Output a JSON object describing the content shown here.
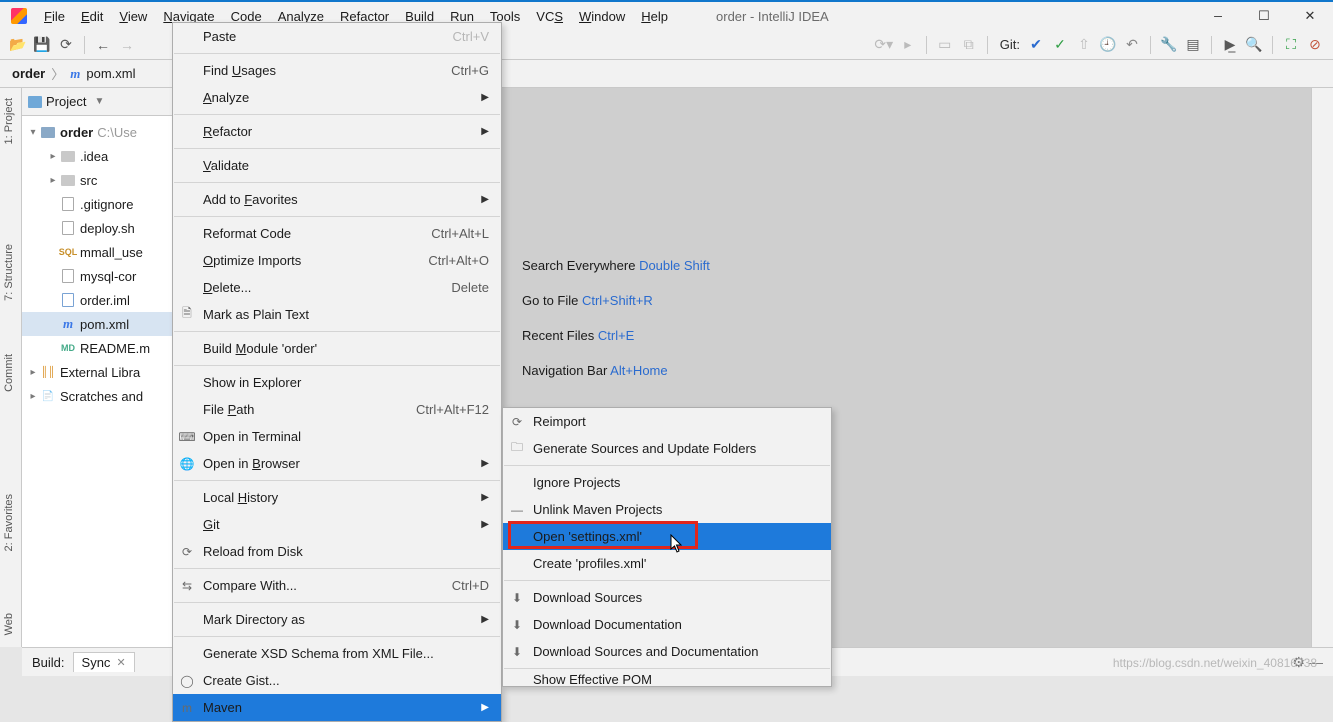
{
  "title": "order - IntelliJ IDEA",
  "menu": [
    "File",
    "Edit",
    "View",
    "Navigate",
    "Code",
    "Analyze",
    "Refactor",
    "Build",
    "Run",
    "Tools",
    "VCS",
    "Window",
    "Help"
  ],
  "toolbar_git_label": "Git:",
  "breadcrumb": {
    "root": "order",
    "file": "pom.xml"
  },
  "sidebar_tabs": {
    "project": "1: Project",
    "structure": "7: Structure",
    "commit": "Commit",
    "favorites": "2: Favorites",
    "web": "Web"
  },
  "project_header": "Project",
  "tree": {
    "root": "order",
    "root_path": "C:\\Use",
    "items": [
      {
        "label": ".idea",
        "kind": "folder"
      },
      {
        "label": "src",
        "kind": "folder"
      },
      {
        "label": ".gitignore",
        "kind": "file"
      },
      {
        "label": "deploy.sh",
        "kind": "file"
      },
      {
        "label": "mmall_use",
        "kind": "sql"
      },
      {
        "label": "mysql-cor",
        "kind": "file"
      },
      {
        "label": "order.iml",
        "kind": "iml"
      },
      {
        "label": "pom.xml",
        "kind": "pom",
        "selected": true
      },
      {
        "label": "README.m",
        "kind": "md"
      }
    ],
    "external": "External Libra",
    "scratches": "Scratches and"
  },
  "editor_hints": [
    {
      "t": "Search Everywhere ",
      "k": "Double Shift"
    },
    {
      "t": "Go to File ",
      "k": "Ctrl+Shift+R"
    },
    {
      "t": "Recent Files ",
      "k": "Ctrl+E"
    },
    {
      "t": "Navigation Bar ",
      "k": "Alt+Home"
    }
  ],
  "ctx1": [
    {
      "type": "item",
      "label": "Paste",
      "shortcut": "Ctrl+V",
      "disabled": true
    },
    {
      "type": "sep"
    },
    {
      "type": "item",
      "label": "Find Usages",
      "underline": "U",
      "shortcut": "Ctrl+G"
    },
    {
      "type": "item",
      "label": "Analyze",
      "underline": "A",
      "submenu": true
    },
    {
      "type": "sep"
    },
    {
      "type": "item",
      "label": "Refactor",
      "underline": "R",
      "submenu": true
    },
    {
      "type": "sep"
    },
    {
      "type": "item",
      "label": "Validate",
      "underline": "V"
    },
    {
      "type": "sep"
    },
    {
      "type": "item",
      "label": "Add to Favorites",
      "underline": "F",
      "submenu": true
    },
    {
      "type": "sep"
    },
    {
      "type": "item",
      "label": "Reformat Code",
      "shortcut": "Ctrl+Alt+L"
    },
    {
      "type": "item",
      "label": "Optimize Imports",
      "underline": "O",
      "shortcut": "Ctrl+Alt+O"
    },
    {
      "type": "item",
      "label": "Delete...",
      "underline": "D",
      "shortcut": "Delete"
    },
    {
      "type": "item",
      "label": "Mark as Plain Text",
      "icon": "plain"
    },
    {
      "type": "sep"
    },
    {
      "type": "item",
      "label": "Build Module 'order'",
      "underline": "M"
    },
    {
      "type": "sep"
    },
    {
      "type": "item",
      "label": "Show in Explorer"
    },
    {
      "type": "item",
      "label": "File Path",
      "underline": "P",
      "shortcut": "Ctrl+Alt+F12"
    },
    {
      "type": "item",
      "label": "Open in Terminal",
      "icon": "terminal"
    },
    {
      "type": "item",
      "label": "Open in Browser",
      "underline": "B",
      "icon": "globe",
      "submenu": true
    },
    {
      "type": "sep"
    },
    {
      "type": "item",
      "label": "Local History",
      "underline": "H",
      "submenu": true
    },
    {
      "type": "item",
      "label": "Git",
      "underline": "G",
      "submenu": true
    },
    {
      "type": "item",
      "label": "Reload from Disk",
      "icon": "reload"
    },
    {
      "type": "sep"
    },
    {
      "type": "item",
      "label": "Compare With...",
      "icon": "compare",
      "shortcut": "Ctrl+D"
    },
    {
      "type": "sep"
    },
    {
      "type": "item",
      "label": "Mark Directory as",
      "disabled": true,
      "submenu": true
    },
    {
      "type": "sep"
    },
    {
      "type": "item",
      "label": "Generate XSD Schema from XML File..."
    },
    {
      "type": "item",
      "label": "Create Gist...",
      "icon": "github"
    },
    {
      "type": "item",
      "label": "Maven",
      "icon": "maven",
      "selected": true,
      "submenu": true
    }
  ],
  "ctx2": [
    {
      "label": "Reimport",
      "icon": "reload"
    },
    {
      "label": "Generate Sources and Update Folders",
      "icon": "folders"
    },
    {
      "type": "sep"
    },
    {
      "label": "Ignore Projects"
    },
    {
      "label": "Unlink Maven Projects",
      "icon": "minus"
    },
    {
      "label": "Open 'settings.xml'",
      "selected": true
    },
    {
      "label": "Create 'profiles.xml'"
    },
    {
      "type": "sep"
    },
    {
      "label": "Download Sources",
      "icon": "download"
    },
    {
      "label": "Download Documentation",
      "icon": "download"
    },
    {
      "label": "Download Sources and Documentation",
      "icon": "download"
    },
    {
      "type": "sep"
    },
    {
      "label": "Show Effective POM",
      "cutoff": true
    }
  ],
  "buildbar": {
    "label": "Build:",
    "tab": "Sync"
  },
  "watermark": "https://blog.csdn.net/weixin_40816738"
}
